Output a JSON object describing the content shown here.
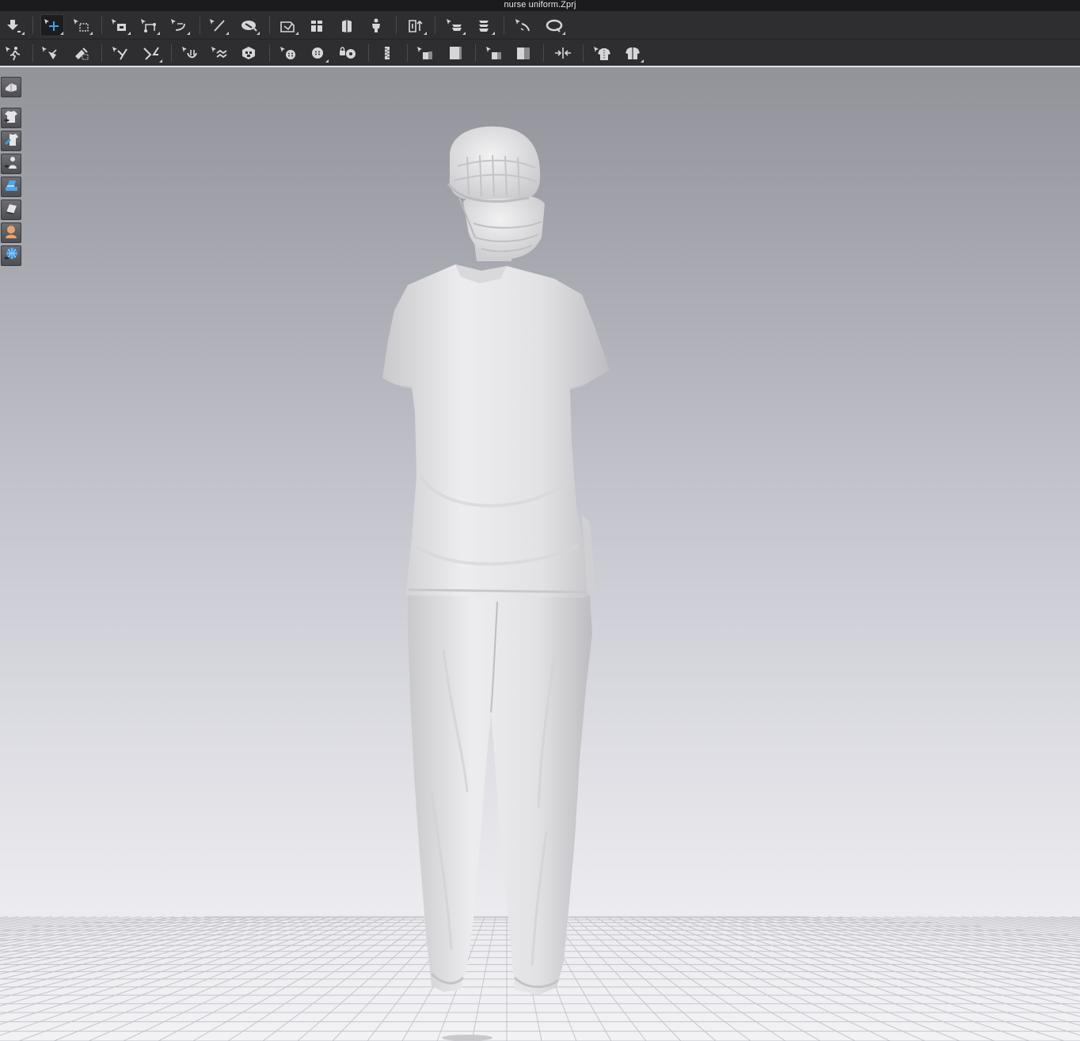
{
  "window": {
    "title": "nurse uniform.Zprj"
  },
  "toolbar_row1": {
    "tools": [
      {
        "name": "simulation-icon"
      },
      {
        "name": "select-move-icon",
        "active": true
      },
      {
        "name": "box-select-icon"
      },
      {
        "name": "transform-pattern-icon"
      },
      {
        "name": "edit-point-icon"
      },
      {
        "name": "edit-curvature-icon"
      },
      {
        "name": "internal-line-icon"
      },
      {
        "name": "segment-sewing-icon"
      },
      {
        "name": "arrangement-point-icon"
      },
      {
        "name": "show-avatar-front-icon"
      },
      {
        "name": "show-avatar-side-icon"
      },
      {
        "name": "show-avatar-icon"
      },
      {
        "name": "fold-arrangement-icon"
      },
      {
        "name": "layer-up-icon"
      },
      {
        "name": "layer-down-icon"
      },
      {
        "name": "tack-icon"
      },
      {
        "name": "tape-measure-icon"
      }
    ]
  },
  "toolbar_row2": {
    "tools": [
      {
        "name": "pose-avatar-icon"
      },
      {
        "name": "pin-icon"
      },
      {
        "name": "pin-box-icon"
      },
      {
        "name": "steam-icon"
      },
      {
        "name": "fold-icon"
      },
      {
        "name": "shrink-icon"
      },
      {
        "name": "puckering-icon"
      },
      {
        "name": "texture-icon"
      },
      {
        "name": "button-icon"
      },
      {
        "name": "select-button-icon"
      },
      {
        "name": "buttonhole-icon"
      },
      {
        "name": "zipper-icon"
      },
      {
        "name": "edit-texture-icon"
      },
      {
        "name": "graphic-icon"
      },
      {
        "name": "transform-graphic-icon"
      },
      {
        "name": "puckering-stitch-icon"
      },
      {
        "name": "gather-icon"
      },
      {
        "name": "measure-garment-icon"
      },
      {
        "name": "fitting-garment-icon"
      }
    ]
  },
  "side_toolbar": {
    "tools": [
      {
        "name": "view-mode-icon"
      },
      {
        "name": "show-garment-icon"
      },
      {
        "name": "garment-render-mode-icon"
      },
      {
        "name": "show-avatar-toggle-icon"
      },
      {
        "name": "avatar-render-mode-icon"
      },
      {
        "name": "show-pattern-icon"
      },
      {
        "name": "skin-render-icon"
      },
      {
        "name": "show-grid-icon"
      }
    ]
  },
  "viewport": {
    "background_top": "#8b8c92",
    "background_bottom": "#f2f2f5",
    "garment_color": "#e4e4e6",
    "grid_color": "#c7c8ce",
    "model": "nurse-figure-back-view"
  },
  "colors": {
    "toolbar_bg": "#2e2e31",
    "titlebar_bg": "#1b1b1d",
    "icon_light": "#d4d4d7",
    "accent_blue": "#3aa5e8"
  }
}
